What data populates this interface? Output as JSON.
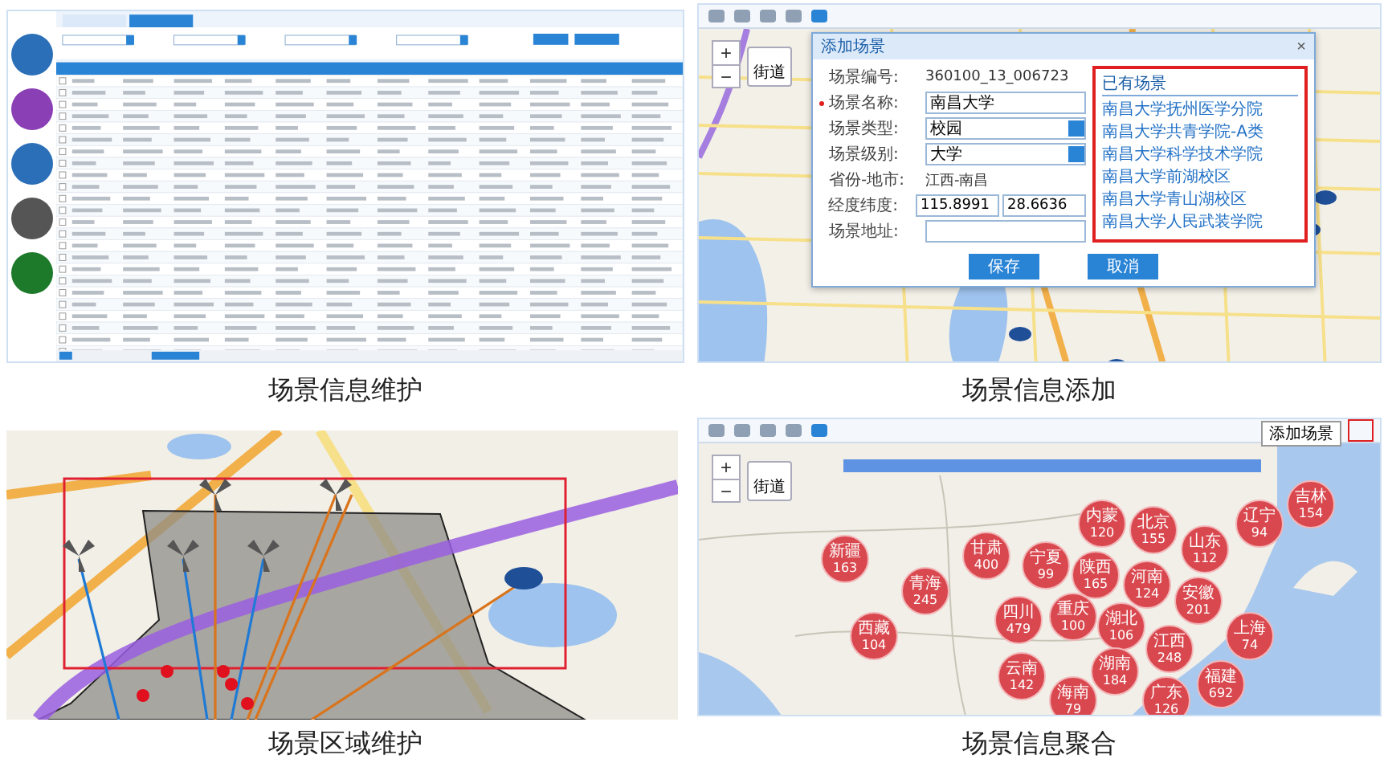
{
  "maintenance": {
    "caption": "场景信息维护"
  },
  "add": {
    "caption": "场景信息添加",
    "zoom_in": "+",
    "zoom_out": "−",
    "street_button": "街道",
    "dialog": {
      "title": "添加场景",
      "close": "×",
      "fields": [
        {
          "label": "场景编号:",
          "kind": "static",
          "value": "360100_13_006723",
          "required": false
        },
        {
          "label": "场景名称:",
          "kind": "text",
          "value": "南昌大学",
          "required": true
        },
        {
          "label": "场景类型:",
          "kind": "select",
          "value": "校园",
          "required": false
        },
        {
          "label": "场景级别:",
          "kind": "select",
          "value": "大学",
          "required": false
        },
        {
          "label": "省份-地市:",
          "kind": "static",
          "value": "江西-南昌",
          "required": false
        },
        {
          "label": "经度纬度:",
          "kind": "pair",
          "value": "115.8991",
          "value2": "28.6636",
          "required": false
        },
        {
          "label": "场景地址:",
          "kind": "text",
          "required": false
        }
      ],
      "existing": {
        "title": "已有场景",
        "items": [
          "南昌大学抚州医学分院",
          "南昌大学共青学院-A类",
          "南昌大学科学技术学院",
          "南昌大学前湖校区",
          "南昌大学青山湖校区",
          "南昌大学人民武装学院"
        ]
      },
      "buttons": [
        "保存",
        "取消"
      ]
    }
  },
  "region": {
    "caption": "场景区域维护"
  },
  "aggregate": {
    "caption": "场景信息聚合",
    "zoom_in": "+",
    "zoom_out": "−",
    "street_button": "街道",
    "add_button": "添加场景",
    "clusters": [
      {
        "name": "新疆",
        "count": "163"
      },
      {
        "name": "青海",
        "count": "245"
      },
      {
        "name": "西藏",
        "count": "104"
      },
      {
        "name": "甘肃",
        "count": "400"
      },
      {
        "name": "四川",
        "count": "479"
      },
      {
        "name": "云南",
        "count": "142"
      },
      {
        "name": "宁夏",
        "count": "99"
      },
      {
        "name": "重庆",
        "count": "100"
      },
      {
        "name": "陕西",
        "count": "165"
      },
      {
        "name": "内蒙",
        "count": "120"
      },
      {
        "name": "北京",
        "count": "155"
      },
      {
        "name": "河南",
        "count": "124"
      },
      {
        "name": "湖北",
        "count": "106"
      },
      {
        "name": "湖南",
        "count": "184"
      },
      {
        "name": "海南",
        "count": "79"
      },
      {
        "name": "广东",
        "count": "126"
      },
      {
        "name": "江西",
        "count": "248"
      },
      {
        "name": "安徽",
        "count": "201"
      },
      {
        "name": "山东",
        "count": "112"
      },
      {
        "name": "福建",
        "count": "692"
      },
      {
        "name": "上海",
        "count": "74"
      },
      {
        "name": "辽宁",
        "count": "94"
      },
      {
        "name": "吉林",
        "count": "154"
      }
    ]
  }
}
